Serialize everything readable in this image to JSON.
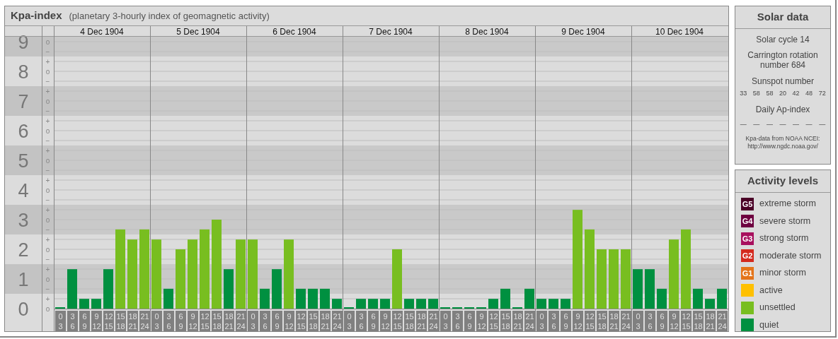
{
  "header": {
    "title": "Kpa-index",
    "subtitle": "(planetary 3-hourly index of geomagnetic activity)"
  },
  "chart": {
    "scale": [
      {
        "marks": [
          "o",
          "−"
        ]
      },
      {
        "marks": [
          "+",
          "o",
          "−"
        ]
      },
      {
        "marks": [
          "+",
          "o",
          "−"
        ]
      },
      {
        "marks": [
          "+",
          "o",
          "−"
        ]
      },
      {
        "marks": [
          "+",
          "o",
          "−"
        ]
      },
      {
        "marks": [
          "+",
          "o",
          "−"
        ]
      },
      {
        "marks": [
          "+",
          "o",
          "−"
        ]
      },
      {
        "marks": [
          "+",
          "o",
          "−"
        ]
      },
      {
        "marks": [
          "+",
          "o",
          "−"
        ]
      },
      {
        "marks": [
          "+",
          "o"
        ]
      }
    ],
    "days": [
      {
        "date": "4 Dec 1904",
        "slots": [
          {
            "from": "0",
            "to": "3"
          },
          {
            "from": "3",
            "to": "6"
          },
          {
            "from": "6",
            "to": "9"
          },
          {
            "from": "9",
            "to": "12"
          },
          {
            "from": "12",
            "to": "15"
          },
          {
            "from": "15",
            "to": "18"
          },
          {
            "from": "18",
            "to": "21"
          },
          {
            "from": "21",
            "to": "24"
          }
        ]
      },
      {
        "date": "5 Dec 1904",
        "slots": [
          {
            "from": "0",
            "to": "3"
          },
          {
            "from": "3",
            "to": "6"
          },
          {
            "from": "6",
            "to": "9"
          },
          {
            "from": "9",
            "to": "12"
          },
          {
            "from": "12",
            "to": "15"
          },
          {
            "from": "15",
            "to": "18"
          },
          {
            "from": "18",
            "to": "21"
          },
          {
            "from": "21",
            "to": "24"
          }
        ]
      },
      {
        "date": "6 Dec 1904",
        "slots": [
          {
            "from": "0",
            "to": "3"
          },
          {
            "from": "3",
            "to": "6"
          },
          {
            "from": "6",
            "to": "9"
          },
          {
            "from": "9",
            "to": "12"
          },
          {
            "from": "12",
            "to": "15"
          },
          {
            "from": "15",
            "to": "18"
          },
          {
            "from": "18",
            "to": "21"
          },
          {
            "from": "21",
            "to": "24"
          }
        ]
      },
      {
        "date": "7 Dec 1904",
        "slots": [
          {
            "from": "0",
            "to": "3"
          },
          {
            "from": "3",
            "to": "6"
          },
          {
            "from": "6",
            "to": "9"
          },
          {
            "from": "9",
            "to": "12"
          },
          {
            "from": "12",
            "to": "15"
          },
          {
            "from": "15",
            "to": "18"
          },
          {
            "from": "18",
            "to": "21"
          },
          {
            "from": "21",
            "to": "24"
          }
        ]
      },
      {
        "date": "8 Dec 1904",
        "slots": [
          {
            "from": "0",
            "to": "3"
          },
          {
            "from": "3",
            "to": "6"
          },
          {
            "from": "6",
            "to": "9"
          },
          {
            "from": "9",
            "to": "12"
          },
          {
            "from": "12",
            "to": "15"
          },
          {
            "from": "15",
            "to": "18"
          },
          {
            "from": "18",
            "to": "21"
          },
          {
            "from": "21",
            "to": "24"
          }
        ]
      },
      {
        "date": "9 Dec 1904",
        "slots": [
          {
            "from": "0",
            "to": "3"
          },
          {
            "from": "3",
            "to": "6"
          },
          {
            "from": "6",
            "to": "9"
          },
          {
            "from": "9",
            "to": "12"
          },
          {
            "from": "12",
            "to": "15"
          },
          {
            "from": "15",
            "to": "18"
          },
          {
            "from": "18",
            "to": "21"
          },
          {
            "from": "21",
            "to": "24"
          }
        ]
      },
      {
        "date": "10 Dec 1904",
        "slots": [
          {
            "from": "0",
            "to": "3"
          },
          {
            "from": "3",
            "to": "6"
          },
          {
            "from": "6",
            "to": "9"
          },
          {
            "from": "9",
            "to": "12"
          },
          {
            "from": "12",
            "to": "15"
          },
          {
            "from": "15",
            "to": "18"
          },
          {
            "from": "18",
            "to": "21"
          },
          {
            "from": "21",
            "to": "24"
          }
        ]
      }
    ],
    "chart_data": {
      "type": "bar",
      "grid": true,
      "stacked": true,
      "ylim": [
        0,
        9
      ],
      "yticks": [
        0,
        1,
        2,
        3,
        4,
        5,
        6,
        7,
        8,
        9
      ],
      "categories": [
        null,
        null,
        null,
        null,
        null,
        null,
        null,
        null,
        null,
        null,
        null,
        null,
        null,
        null,
        null,
        null,
        null,
        null,
        null,
        null,
        null,
        null,
        null,
        null,
        null,
        null,
        null,
        null,
        null,
        null,
        null,
        null,
        null,
        null,
        null,
        null,
        null,
        null,
        null,
        null,
        null,
        null,
        null,
        null,
        null,
        null,
        null,
        null,
        null,
        null,
        null,
        null,
        null,
        null,
        null,
        null
      ],
      "series": [
        {
          "color": "#009040",
          "values": [
            0,
            1.33,
            0.33,
            0.33,
            1.33,
            null,
            null,
            null,
            null,
            0.67,
            null,
            null,
            null,
            null,
            1.33,
            null,
            null,
            0.67,
            1.33,
            null,
            0.67,
            0.67,
            0.67,
            0.33,
            0,
            0.33,
            0.33,
            0.33,
            null,
            0.33,
            0.33,
            0.33,
            0,
            0,
            0,
            0,
            0.33,
            0.67,
            0,
            0.67,
            0.33,
            0.33,
            0.33,
            null,
            null,
            null,
            null,
            null,
            1.33,
            1.33,
            0.67,
            null,
            null,
            0.67,
            0.33,
            0.67
          ]
        },
        {
          "color": "#78be20",
          "values": [
            null,
            null,
            null,
            null,
            null,
            2.67,
            2.33,
            2.67,
            2.33,
            null,
            2,
            2.33,
            2.67,
            3,
            null,
            2.33,
            2.33,
            null,
            null,
            2.33,
            null,
            null,
            null,
            null,
            null,
            null,
            null,
            null,
            2,
            null,
            null,
            null,
            null,
            null,
            null,
            null,
            null,
            null,
            null,
            null,
            null,
            null,
            null,
            3.33,
            2.67,
            2,
            2,
            2,
            null,
            null,
            null,
            2.33,
            2.67,
            null,
            null,
            null
          ]
        }
      ]
    }
  },
  "solar": {
    "title": "Solar data",
    "cycle": "Solar cycle 14",
    "rotation": "Carrington rotation number 684",
    "sunspot_label": "Sunspot number",
    "sunspots": [
      "33",
      "58",
      "58",
      "20",
      "42",
      "48",
      "72"
    ],
    "ap_label": "Daily Ap-index",
    "ap_values": [
      "—",
      "—",
      "—",
      "—",
      "—",
      "—",
      "—"
    ],
    "source": "Kpa-data from NOAA NCEI:",
    "source_url": "http://www.ngdc.noaa.gov/"
  },
  "legend": {
    "title": "Activity levels",
    "items": [
      {
        "code": "G5",
        "label": "extreme storm",
        "color": "#4a0026"
      },
      {
        "code": "G4",
        "label": "severe storm",
        "color": "#6e0040"
      },
      {
        "code": "G3",
        "label": "strong storm",
        "color": "#a8105e"
      },
      {
        "code": "G2",
        "label": "moderate storm",
        "color": "#d42a1e"
      },
      {
        "code": "G1",
        "label": "minor storm",
        "color": "#e4741a"
      },
      {
        "label": "active",
        "color": "#ffc000"
      },
      {
        "label": "unsettled",
        "color": "#78be20"
      },
      {
        "label": "quiet",
        "color": "#009040"
      }
    ]
  }
}
